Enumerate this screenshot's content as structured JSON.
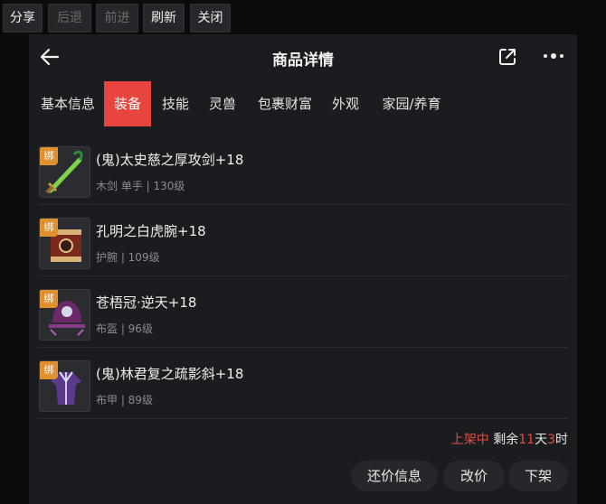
{
  "toolbar": {
    "share": "分享",
    "back": "后退",
    "forward": "前进",
    "refresh": "刷新",
    "close": "关闭"
  },
  "header": {
    "title": "商品详情",
    "back_icon": "arrow-left-icon",
    "share_icon": "external-share-icon",
    "more_icon": "more-dots-icon"
  },
  "tabs": [
    {
      "label": "基本信息",
      "active": false
    },
    {
      "label": "装备",
      "active": true
    },
    {
      "label": "技能",
      "active": false
    },
    {
      "label": "灵兽",
      "active": false
    },
    {
      "label": "包裹财富",
      "active": false
    },
    {
      "label": "外观",
      "active": false
    },
    {
      "label": "家园/养育",
      "active": false
    }
  ],
  "items": [
    {
      "name": "(鬼)太史慈之厚攻剑+18",
      "meta": "木剑 单手 | 130级",
      "badge": "绑",
      "icon": "sword-icon"
    },
    {
      "name": "孔明之白虎腕+18",
      "meta": "护腕 | 109级",
      "badge": "绑",
      "icon": "bracer-icon"
    },
    {
      "name": "苍梧冠·逆天+18",
      "meta": "布盔 | 96级",
      "badge": "绑",
      "icon": "helmet-icon"
    },
    {
      "name": "(鬼)林君复之疏影斜+18",
      "meta": "布甲 | 89级",
      "badge": "绑",
      "icon": "robe-icon"
    }
  ],
  "status": {
    "listed": "上架中",
    "remaining_label": "剩余",
    "days": "11",
    "day_unit": "天",
    "hours": "3",
    "hour_unit": "时"
  },
  "actions": {
    "counter_offer": "还价信息",
    "edit_price": "改价",
    "unlist": "下架"
  },
  "colors": {
    "accent": "#e8453f",
    "badge": "#e0902f",
    "panel_bg": "#1b1c1f"
  }
}
